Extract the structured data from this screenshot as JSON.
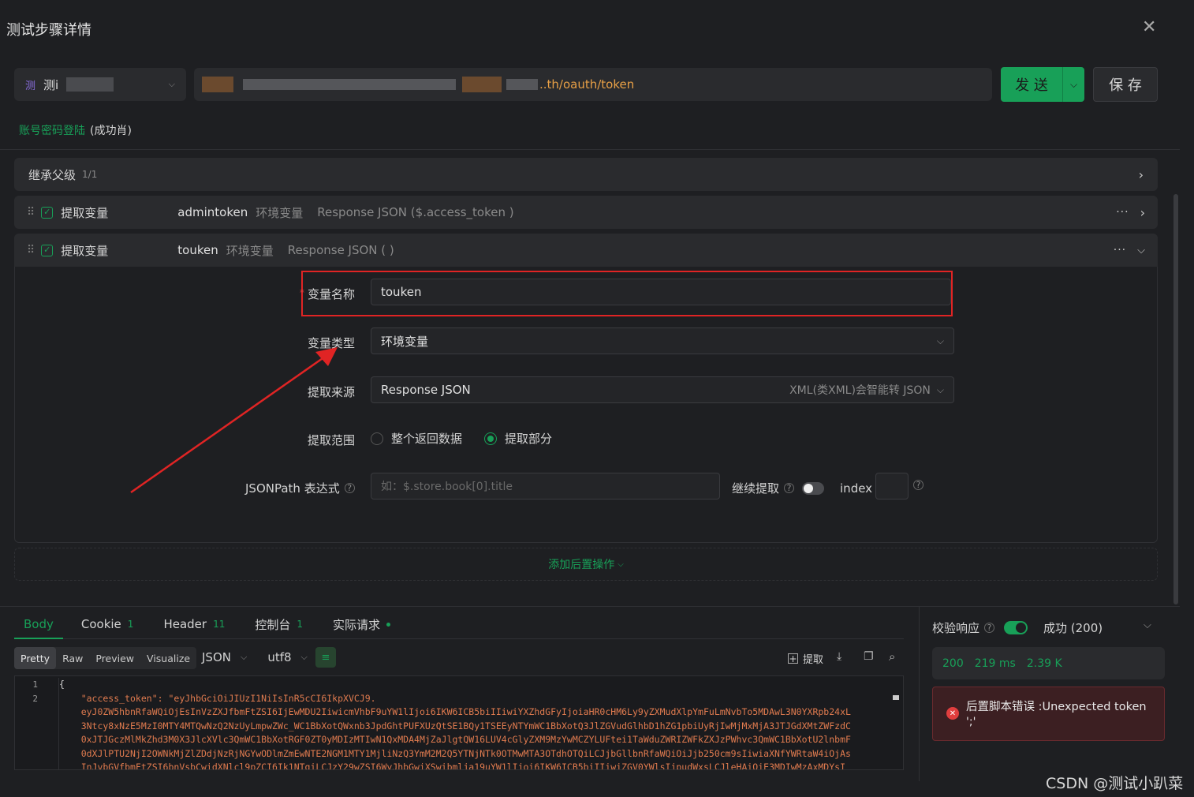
{
  "dialog": {
    "title": "测试步骤详情"
  },
  "request": {
    "step_badge": "测",
    "step_name": "测i",
    "url_suffix": "..th/oauth/token",
    "send_label": "发 送",
    "save_label": "保 存",
    "api_link": "账号密码登陆",
    "api_status": "(成功肖)"
  },
  "inherit": {
    "label": "继承父级",
    "count": "1/1"
  },
  "extract1": {
    "title": "提取变量",
    "var_name": "admintoken",
    "var_type": "环境变量",
    "source": "Response JSON ($.access_token )"
  },
  "extract2": {
    "title": "提取变量",
    "var_name": "touken",
    "var_type": "环境变量",
    "source": "Response JSON ( )"
  },
  "form": {
    "name_label": "变量名称",
    "name_value": "touken",
    "type_label": "变量类型",
    "type_value": "环境变量",
    "source_label": "提取来源",
    "source_value": "Response JSON",
    "source_hint": "XML(类XML)会智能转 JSON",
    "range_label": "提取范围",
    "range_opt_all": "整个返回数据",
    "range_opt_part": "提取部分",
    "jsonpath_label": "JSONPath 表达式",
    "jsonpath_placeholder": "如：$.store.book[0].title",
    "continue_label": "继续提取",
    "index_label": "index"
  },
  "add_post": "添加后置操作",
  "response_tabs": [
    {
      "label": "Body",
      "count": ""
    },
    {
      "label": "Cookie",
      "count": "1"
    },
    {
      "label": "Header",
      "count": "11"
    },
    {
      "label": "控制台",
      "count": "1"
    },
    {
      "label": "实际请求",
      "count": ""
    }
  ],
  "view_modes": [
    "Pretty",
    "Raw",
    "Preview",
    "Visualize"
  ],
  "format": "JSON",
  "encoding": "utf8",
  "extract_btn": "提取",
  "code": {
    "line_numbers": [
      "1",
      "2"
    ],
    "lines": [
      "{",
      "    \"access_token\": \"eyJhbGciOiJIUzI1NiIsInR5cCI6IkpXVCJ9.",
      "    eyJ0ZW5hbnRfaWQiOjEsInVzZXJfbmFtZSI6IjEwMDU2IiwicmVhbF9uYW1lIjoi6IKW6ICB5biIIiwiYXZhdGFyIjoiaHR0cHM6Ly9yZXMudXlpYmFuLmNvbTo5MDAwL3N0YXRpb24xL",
      "    3Ntcy8xNzE5MzI0MTY4MTQwNzQ2NzUyLmpwZWc_WC1BbXotQWxnb3JpdGhtPUFXUzQtSE1BQy1TSEEyNTYmWC1BbXotQ3JlZGVudGlhbD1hZG1pbiUyRjIwMjMxMjA3JTJGdXMtZWFzdC",
      "    0xJTJGczMlMkZhd3M0X3JlcXVlc3QmWC1BbXotRGF0ZT0yMDIzMTIwN1QxMDA4MjZaJlgtQW16LUV4cGlyZXM9MzYwMCZYLUFtei1TaWduZWRIZWFkZXJzPWhvc3QmWC1BbXotU2lnbmF",
      "    0dXJlPTU2NjI2OWNkMjZlZDdjNzRjNGYwODlmZmEwNTE2NGM1MTY1MjliNzQ3YmM2M2Q5YTNjNTk0OTMwMTA3OTdhOTQiLCJjbGllbnRfaWQiOiJjb250cm9sIiwiaXNfYWRtaW4iOjAs",
      "    InJvbGVfbmFtZSI6bnVsbCwidXNlcl9pZCI6Ik1NTgiLCJzY29wZSI6WyJhbGwiXSwibmlja19uYW1lIjoi6IKW6ICB5biIIiwiZGV0YWlsIjpudWxsLCJleHAiOiE3MDIwMzAxMDYsI"
    ]
  },
  "validate": {
    "label": "校验响应",
    "status": "成功 (200)",
    "code": "200",
    "time": "219 ms",
    "size": "2.39 K",
    "error": "后置脚本错误 :Unexpected token",
    "error2": "';'"
  },
  "watermark": "CSDN @测试小趴菜",
  "colors": {
    "accent": "#18a058",
    "error": "#e03e3e",
    "annotation": "#e02424"
  }
}
